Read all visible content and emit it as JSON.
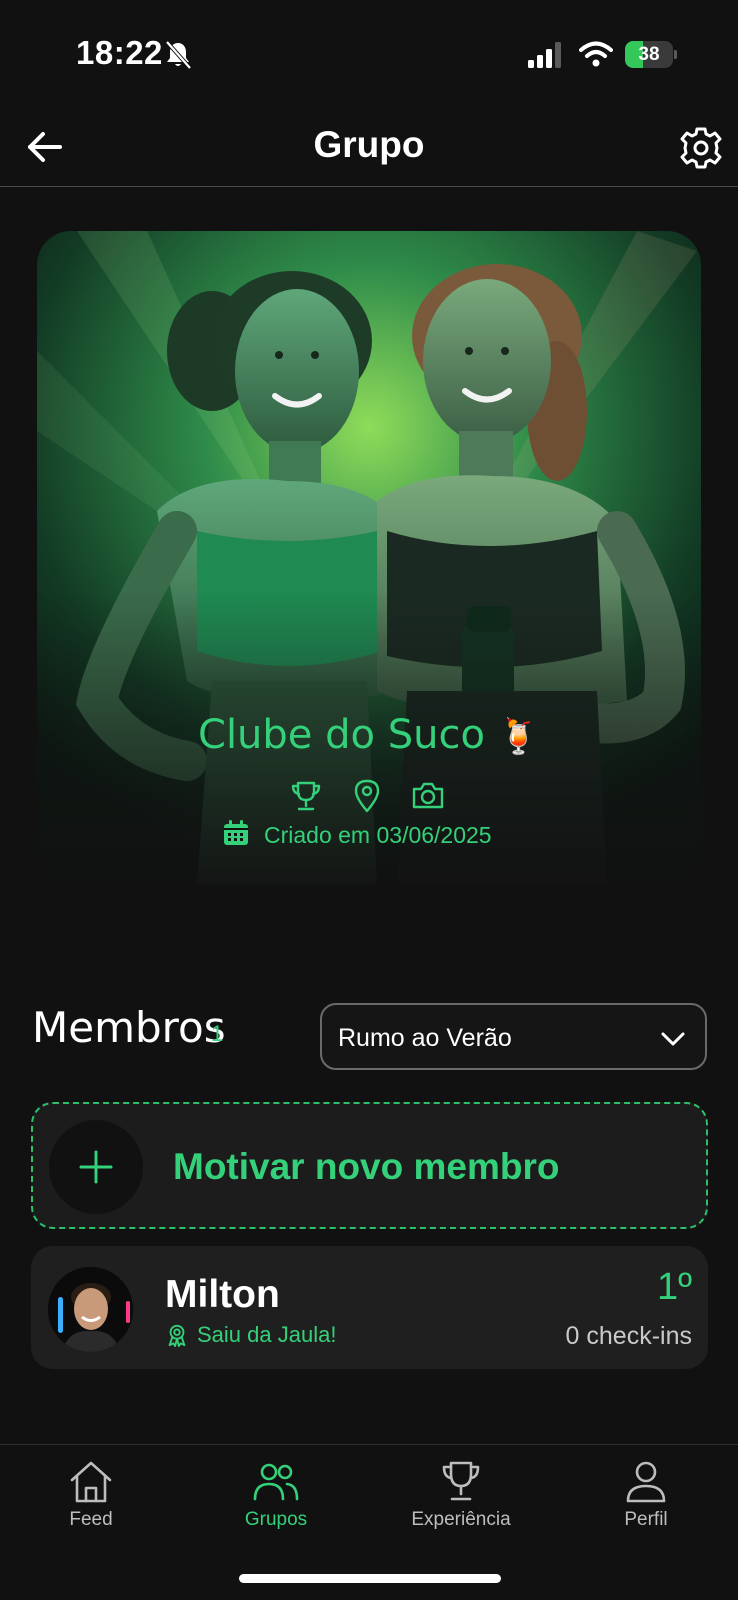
{
  "status_bar": {
    "time": "18:22",
    "battery": "38",
    "battery_level": 0.38,
    "icons": [
      "bell-slash-icon",
      "cellular-signal-icon",
      "wifi-icon",
      "battery-charging-icon"
    ]
  },
  "header": {
    "title": "Grupo",
    "back_icon": "arrow-left-icon",
    "settings_icon": "gear-icon"
  },
  "group": {
    "name": "Clube do Suco",
    "emoji": "🍹",
    "action_icons": [
      "trophy-icon",
      "map-pin-icon",
      "camera-icon"
    ],
    "created_label": "Criado em 03/06/2025",
    "created_icon": "calendar-icon"
  },
  "members": {
    "title": "Membros",
    "count": "1",
    "filter_selected": "Rumo ao Verão",
    "add_label": "Motivar novo membro",
    "list": [
      {
        "name": "Milton",
        "badge": "Saiu da Jaula!",
        "badge_icon": "award-ribbon-icon",
        "rank": "1º",
        "checkins": "0 check-ins"
      }
    ]
  },
  "tabbar": {
    "items": [
      {
        "label": "Feed",
        "icon": "home-icon",
        "active": false
      },
      {
        "label": "Grupos",
        "icon": "users-icon",
        "active": true
      },
      {
        "label": "Experiência",
        "icon": "trophy-icon",
        "active": false
      },
      {
        "label": "Perfil",
        "icon": "user-icon",
        "active": false
      }
    ]
  },
  "colors": {
    "background": "#111111",
    "accent": "#34d17a",
    "card": "#1f1f1f"
  }
}
